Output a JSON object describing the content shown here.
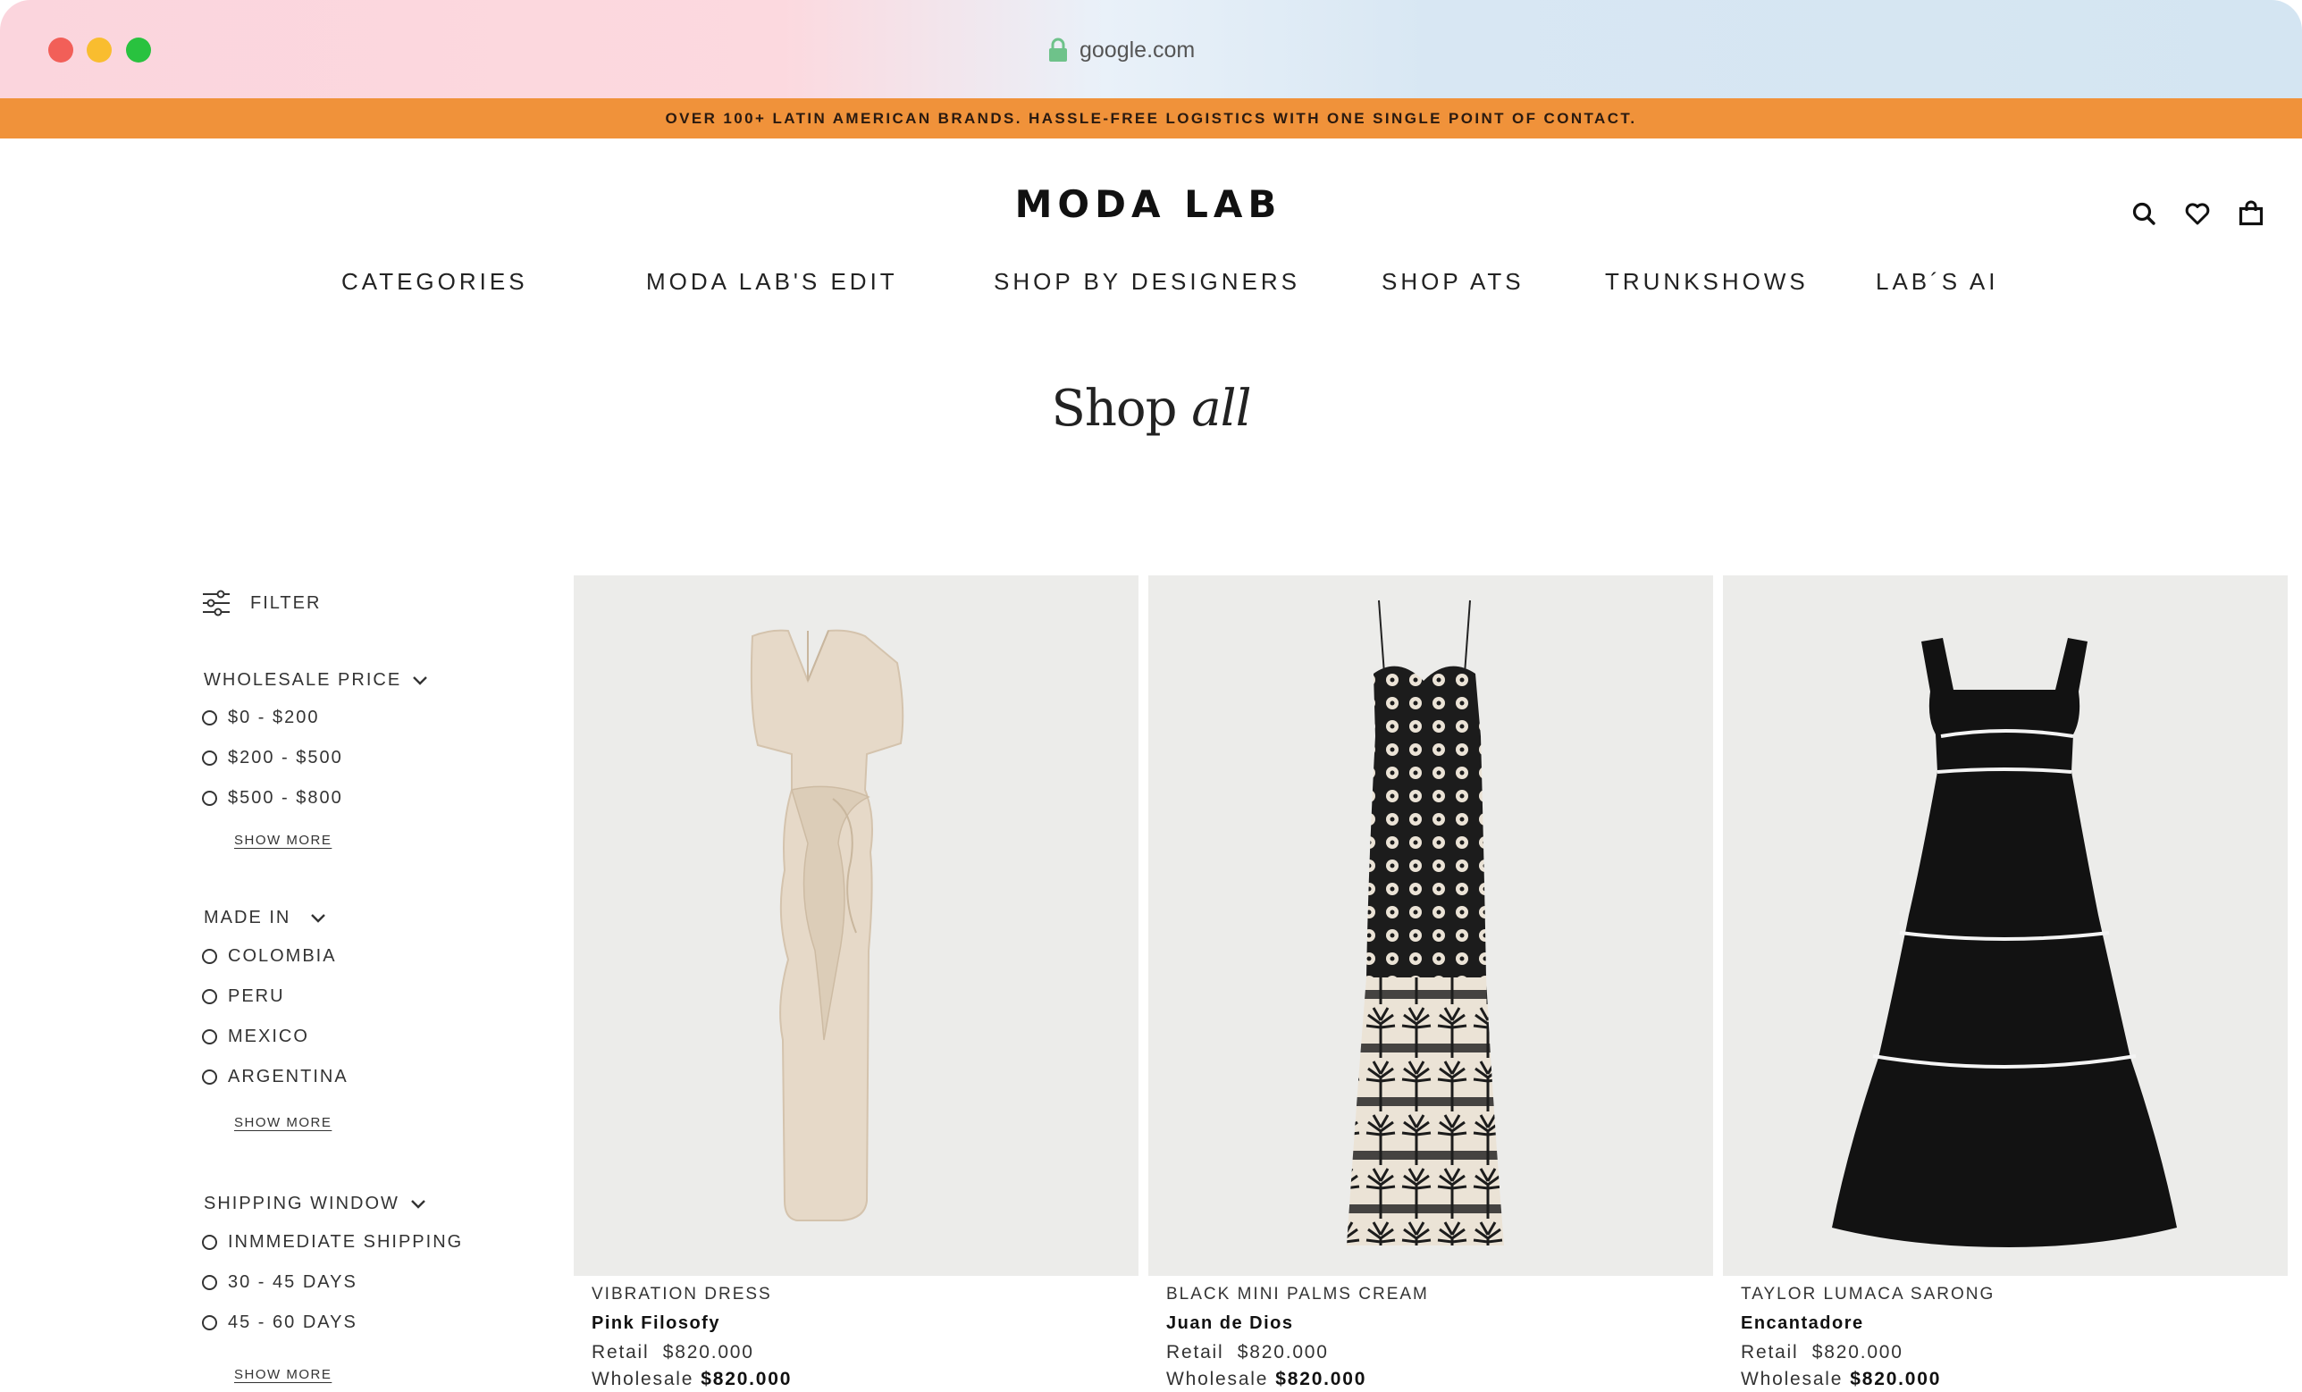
{
  "browser": {
    "url": "google.com",
    "lock_icon": "lock-icon"
  },
  "promo": {
    "text": "OVER 100+ LATIN AMERICAN BRANDS. HASSLE-FREE LOGISTICS WITH ONE SINGLE POINT OF CONTACT."
  },
  "header": {
    "logo": "MODA LAB",
    "icons": [
      "search-icon",
      "heart-icon",
      "shopping-bag-icon"
    ]
  },
  "nav": {
    "items": [
      {
        "label": "CATEGORIES"
      },
      {
        "label": "MODA LAB'S EDIT"
      },
      {
        "label": "SHOP BY DESIGNERS"
      },
      {
        "label": "SHOP ATS"
      },
      {
        "label": "TRUNKSHOWS"
      },
      {
        "label": "LAB´S AI"
      }
    ]
  },
  "page": {
    "title_regular": "Shop",
    "title_italic": "all"
  },
  "filters": {
    "label": "FILTER",
    "groups": [
      {
        "title": "WHOLESALE PRICE",
        "options": [
          "$0 - $200",
          "$200 - $500",
          "$500 - $800"
        ],
        "show_more": "SHOW MORE"
      },
      {
        "title": "MADE IN",
        "options": [
          "COLOMBIA",
          "PERU",
          "MEXICO",
          "ARGENTINA"
        ],
        "show_more": "SHOW MORE"
      },
      {
        "title": "SHIPPING WINDOW",
        "options": [
          "INMMEDIATE SHIPPING",
          "30 - 45 DAYS",
          "45 - 60 DAYS"
        ],
        "show_more": "SHOW MORE"
      }
    ]
  },
  "products": [
    {
      "title": "VIBRATION DRESS",
      "brand": "Pink Filosofy",
      "retail_label": "Retail",
      "retail": "$820.000",
      "wholesale_label": "Wholesale",
      "wholesale": "$820.000"
    },
    {
      "title": "BLACK MINI PALMS CREAM",
      "brand": "Juan de Dios",
      "retail_label": "Retail",
      "retail": "$820.000",
      "wholesale_label": "Wholesale",
      "wholesale": "$820.000"
    },
    {
      "title": "TAYLOR LUMACA SARONG",
      "brand": "Encantadore",
      "retail_label": "Retail",
      "retail": "$820.000",
      "wholesale_label": "Wholesale",
      "wholesale": "$820.000"
    }
  ],
  "colors": {
    "promo_bg": "#f0923a",
    "text": "#222222",
    "image_bg": "#ececea"
  }
}
